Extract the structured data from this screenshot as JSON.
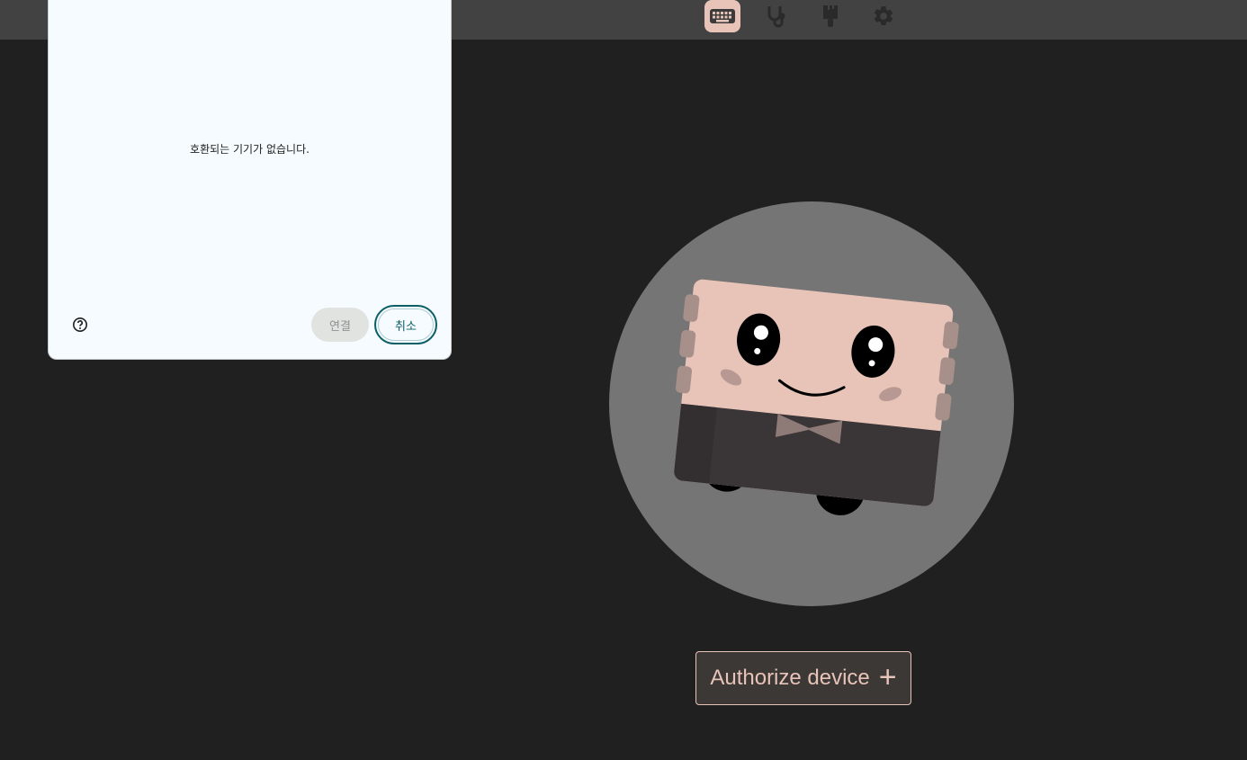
{
  "nav": {
    "items": [
      {
        "name": "keyboard-icon",
        "active": true
      },
      {
        "name": "stethoscope-icon",
        "active": false
      },
      {
        "name": "paintbrush-icon",
        "active": false
      },
      {
        "name": "gear-icon",
        "active": false
      }
    ]
  },
  "dialog": {
    "message": "호환되는 기기가 없습니다.",
    "connect_label": "연결",
    "cancel_label": "취소",
    "help_icon": "help-circle-icon"
  },
  "main": {
    "authorize_label": "Authorize device",
    "authorize_icon": "plus-icon"
  },
  "colors": {
    "background": "#202020",
    "topbar": "#424242",
    "accent": "#e8c3b8",
    "dialog_bg": "#f5fbff",
    "dialog_primary": "#0b5f66"
  }
}
